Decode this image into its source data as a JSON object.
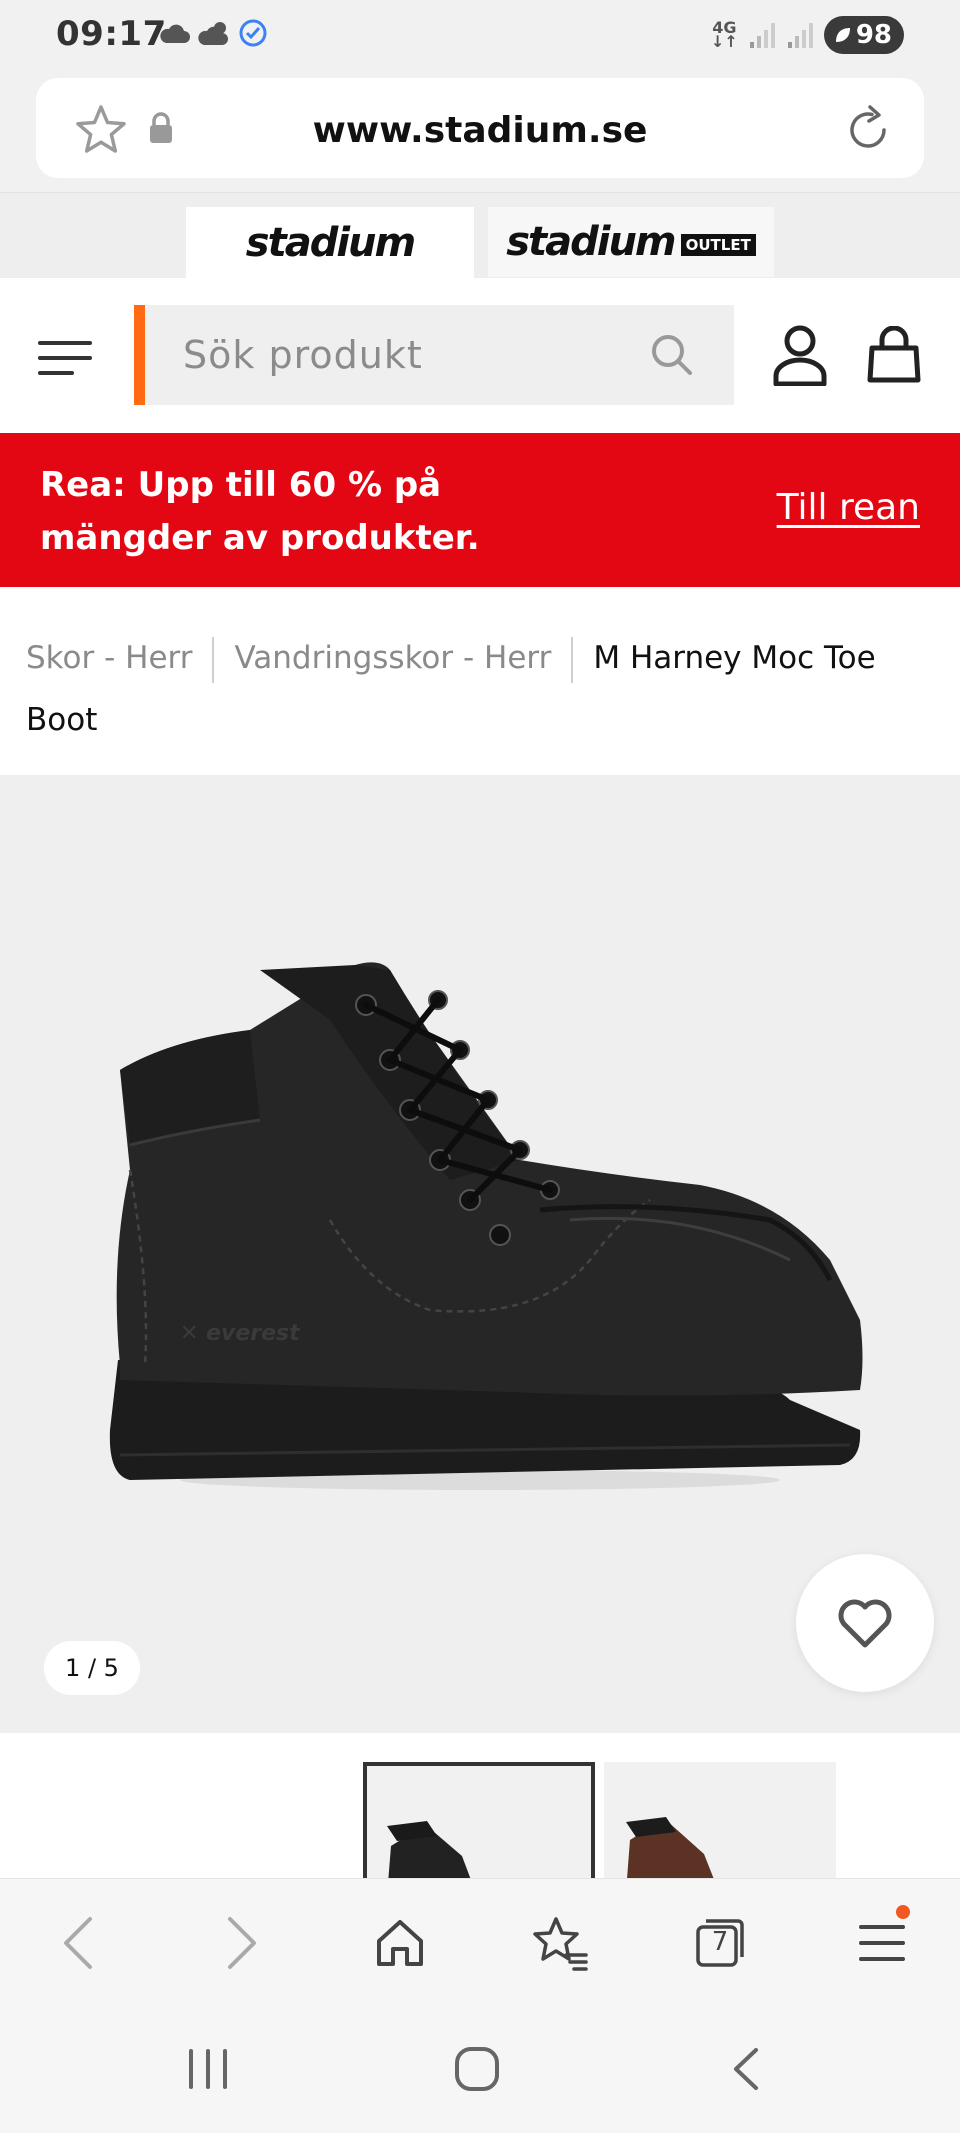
{
  "status_bar": {
    "time": "09:17",
    "network": "4G",
    "battery": "98",
    "icons": [
      "cloud-icon",
      "partly-cloudy-icon",
      "check-circle-icon",
      "signal-icon",
      "battery-icon"
    ]
  },
  "browser": {
    "url": "www.stadium.se",
    "tabs_count": "7"
  },
  "store_tabs": {
    "main_label": "stadium",
    "outlet_label": "stadium",
    "outlet_badge": "OUTLET"
  },
  "search": {
    "placeholder": "Sök produkt"
  },
  "promo": {
    "text": "Rea: Upp till 60 % på mängder av produkter.",
    "link": "Till rean"
  },
  "breadcrumb": {
    "items": [
      "Skor - Herr",
      "Vandringsskor - Herr"
    ],
    "current": "M Harney Moc Toe Boot"
  },
  "product": {
    "image_counter": "1 / 5",
    "thumbnail_count_visible": 2
  },
  "colors": {
    "accent_orange": "#ff6a13",
    "promo_red": "#e30613",
    "notification_dot": "#f05a22"
  }
}
